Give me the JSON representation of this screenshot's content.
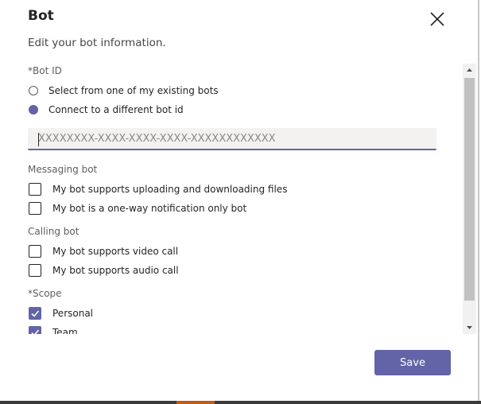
{
  "dialog": {
    "title": "Bot",
    "subtitle": "Edit your bot information."
  },
  "bot_id": {
    "label": "*Bot ID",
    "options": [
      {
        "label": "Select from one of my existing bots",
        "checked": false
      },
      {
        "label": "Connect to a different bot id",
        "checked": true
      }
    ],
    "input_value": "",
    "input_placeholder": "XXXXXXXX-XXXX-XXXX-XXXX-XXXXXXXXXXXX"
  },
  "messaging": {
    "label": "Messaging bot",
    "options": [
      {
        "label": "My bot supports uploading and downloading files",
        "checked": false
      },
      {
        "label": "My bot is a one-way notification only bot",
        "checked": false
      }
    ]
  },
  "calling": {
    "label": "Calling bot",
    "options": [
      {
        "label": "My bot supports video call",
        "checked": false
      },
      {
        "label": "My bot supports audio call",
        "checked": false
      }
    ]
  },
  "scope": {
    "label": "*Scope",
    "options": [
      {
        "label": "Personal",
        "checked": true
      },
      {
        "label": "Team",
        "checked": true
      }
    ]
  },
  "footer": {
    "save_label": "Save"
  },
  "colors": {
    "accent": "#6264a7",
    "text": "#252423",
    "muted": "#605e5c",
    "input_bg": "#f3f2f1"
  },
  "icons": {
    "close": "close-icon",
    "check": "checkmark-icon",
    "scroll_up": "chevron-up-icon",
    "scroll_down": "chevron-down-icon"
  }
}
